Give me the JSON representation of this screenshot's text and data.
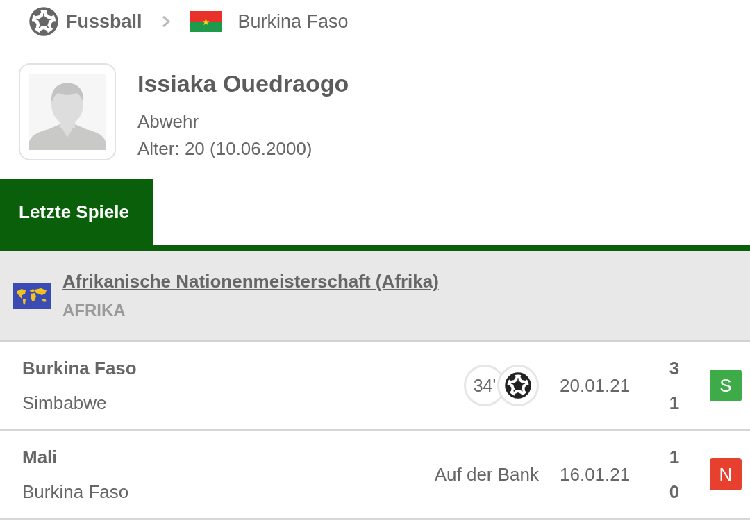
{
  "breadcrumb": {
    "sport": "Fussball",
    "country": "Burkina Faso"
  },
  "player": {
    "name": "Issiaka Ouedraogo",
    "position": "Abwehr",
    "age": "Alter: 20 (10.06.2000)"
  },
  "tabs": [
    {
      "label": "Letzte Spiele",
      "selected": true
    }
  ],
  "competition": {
    "name": "Afrikanische Nationenmeisterschaft (Afrika)",
    "region": "AFRIKA"
  },
  "matches": [
    {
      "home": "Burkina Faso",
      "away": "Simbabwe",
      "event": {
        "kind": "goal",
        "minute": "34'"
      },
      "date": "20.01.21",
      "home_score": "3",
      "away_score": "1",
      "result": "S",
      "color": "#3dab47"
    },
    {
      "home": "Mali",
      "away": "Burkina Faso",
      "event": {
        "kind": "bench",
        "text": "Auf der Bank"
      },
      "date": "16.01.21",
      "home_score": "1",
      "away_score": "0",
      "result": "N",
      "color": "#e8402e"
    }
  ]
}
